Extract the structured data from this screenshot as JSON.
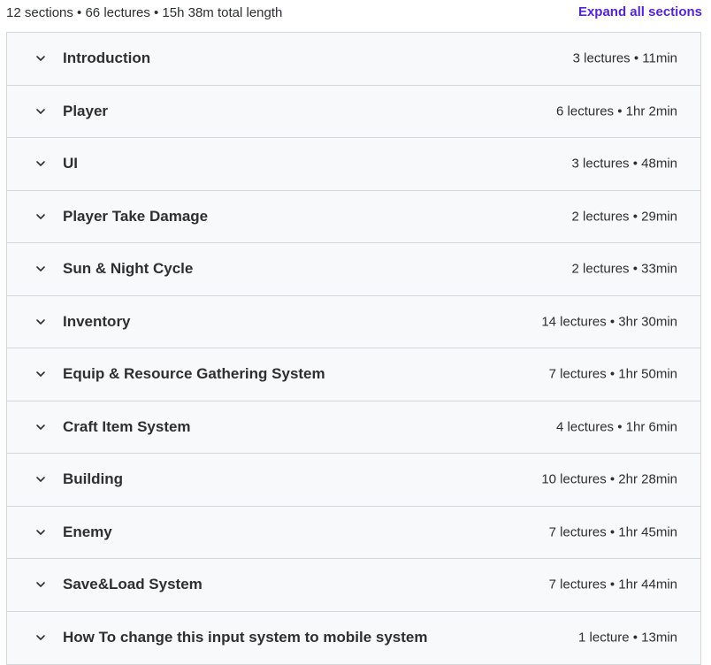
{
  "summary": {
    "text": "12 sections • 66 lectures • 15h 38m total length",
    "expand_label": "Expand all sections"
  },
  "icons": {
    "section_toggle": "chevron-down-icon"
  },
  "colors": {
    "accent": "#5624d0",
    "row_background": "#f7f9fa",
    "border": "#d1d7dc",
    "text": "#2d2f31"
  },
  "sections": [
    {
      "title": "Introduction",
      "meta": "3 lectures • 11min"
    },
    {
      "title": "Player",
      "meta": "6 lectures • 1hr 2min"
    },
    {
      "title": "UI",
      "meta": "3 lectures • 48min"
    },
    {
      "title": "Player Take Damage",
      "meta": "2 lectures • 29min"
    },
    {
      "title": "Sun & Night Cycle",
      "meta": "2 lectures • 33min"
    },
    {
      "title": "Inventory",
      "meta": "14 lectures • 3hr 30min"
    },
    {
      "title": "Equip & Resource Gathering System",
      "meta": "7 lectures • 1hr 50min"
    },
    {
      "title": "Craft Item System",
      "meta": "4 lectures • 1hr 6min"
    },
    {
      "title": "Building",
      "meta": "10 lectures • 2hr 28min"
    },
    {
      "title": "Enemy",
      "meta": "7 lectures • 1hr 45min"
    },
    {
      "title": "Save&Load System",
      "meta": "7 lectures • 1hr 44min"
    },
    {
      "title": "How To change this input system to mobile system",
      "meta": "1 lecture • 13min"
    }
  ]
}
